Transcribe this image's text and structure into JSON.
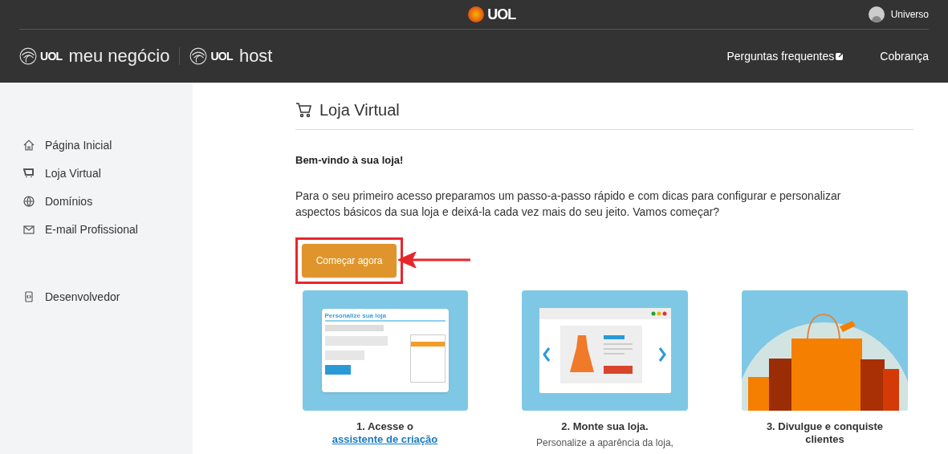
{
  "top_bar": {
    "logo": "UOL",
    "user": "Universo"
  },
  "brand_bar": {
    "brands": [
      {
        "logo": "UOL",
        "name": "meu negócio"
      },
      {
        "logo": "UOL",
        "name": "host"
      }
    ],
    "links": [
      {
        "label": "Perguntas frequentes",
        "external": true
      },
      {
        "label": "Cobrança",
        "external": false
      }
    ]
  },
  "sidebar": {
    "sections": [
      {
        "items": [
          {
            "label": "Página Inicial"
          },
          {
            "label": "Loja Virtual"
          },
          {
            "label": "Domínios"
          },
          {
            "label": "E-mail Profissional"
          }
        ]
      },
      {
        "items": [
          {
            "label": "Desenvolvedor"
          }
        ]
      }
    ]
  },
  "content": {
    "title": "Loja Virtual",
    "welcome": "Bem-vindo à sua loja!",
    "intro": "Para o seu primeiro acesso preparamos um passo-a-passo rápido e com dicas para configurar e personalizar aspectos básicos da sua loja e deixá-la cada vez mais do seu jeito. Vamos começar?",
    "start_button": "Começar agora",
    "steps": [
      {
        "kind": "wizard",
        "drawing_text": "Personalize sua loja",
        "caption": "1. Acesse o ",
        "link": "assistente de criação"
      },
      {
        "kind": "store",
        "caption": "2. Monte sua loja.",
        "description": "Personalize a aparência da loja,"
      },
      {
        "kind": "bags",
        "caption": "3. Divulgue e conquiste clientes"
      }
    ]
  }
}
